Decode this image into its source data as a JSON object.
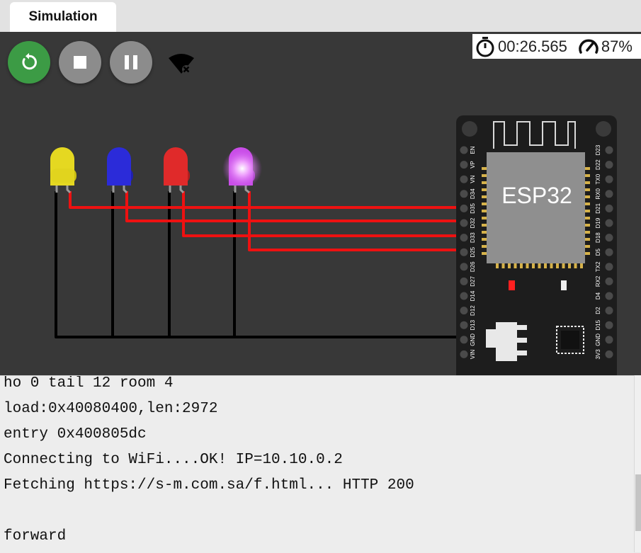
{
  "tabs": [
    {
      "label": "Simulation",
      "active": true
    }
  ],
  "toolbar": {
    "restart_icon": "restart-icon",
    "stop_icon": "stop-icon",
    "pause_icon": "pause-icon",
    "wifi_icon": "wifi-off-icon",
    "restart_color": "#3c9b45",
    "button_color": "#8c8c8c"
  },
  "status": {
    "timer": "00:26.565",
    "speed": "87%"
  },
  "board": {
    "label": "ESP32",
    "left_pins": [
      "EN",
      "VP",
      "VN",
      "D34",
      "D35",
      "D32",
      "D33",
      "D25",
      "D26",
      "D27",
      "D14",
      "D12",
      "D13",
      "GND",
      "VIN"
    ],
    "right_pins": [
      "D23",
      "D22",
      "TX0",
      "RX0",
      "D21",
      "D19",
      "D18",
      "D5",
      "TX2",
      "RX2",
      "D4",
      "D2",
      "D15",
      "GND",
      "3V3"
    ]
  },
  "leds": [
    {
      "name": "yellow-led",
      "color": "#e5d821",
      "lit": false
    },
    {
      "name": "blue-led",
      "color": "#2b2bd9",
      "lit": false
    },
    {
      "name": "red-led",
      "color": "#e02a2a",
      "lit": false
    },
    {
      "name": "purple-led",
      "color": "#c94de8",
      "lit": true
    }
  ],
  "wire_colors": {
    "signal": "#ee1111",
    "ground": "#000000"
  },
  "console": {
    "lines": [
      "ho 0 tail 12 room 4",
      "load:0x40080400,len:2972",
      "entry 0x400805dc",
      "Connecting to WiFi....OK! IP=10.10.0.2",
      "Fetching https://s-m.com.sa/f.html... HTTP 200",
      "",
      "forward"
    ]
  }
}
